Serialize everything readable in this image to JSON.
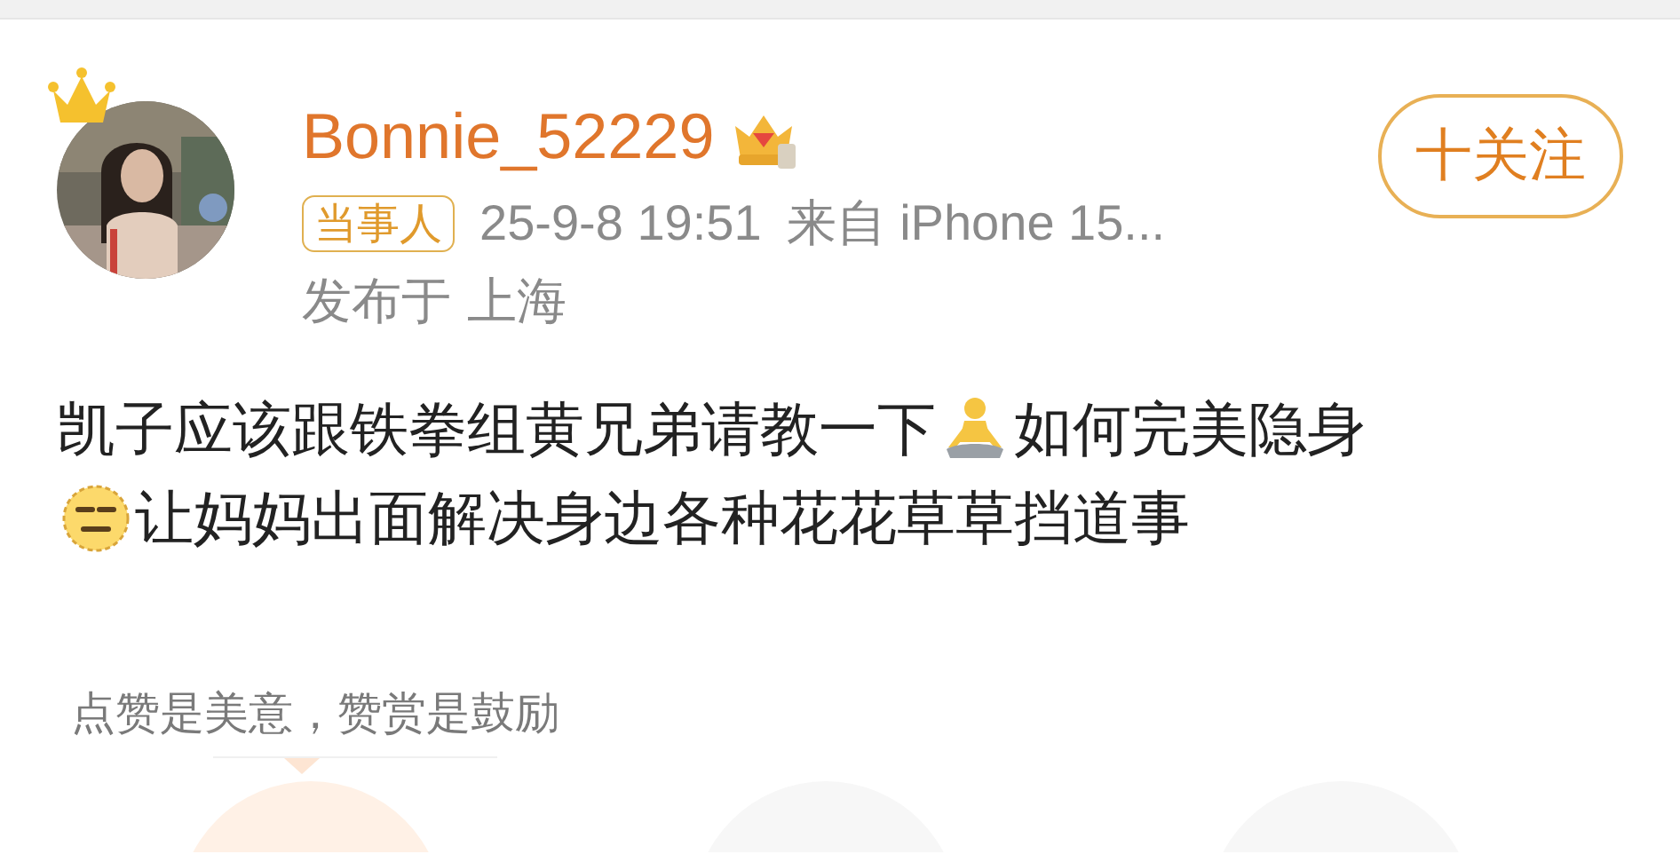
{
  "author": {
    "name": "Bonnie_52229",
    "badge": "当事人",
    "time": "25-9-8 19:51",
    "source": "来自 iPhone 15...",
    "location": "发布于 上海"
  },
  "follow_button": {
    "label": "十关注"
  },
  "post": {
    "lines": [
      {
        "segments": [
          {
            "kind": "text",
            "text": "凯子应该跟铁拳组黄兄弟请教一下"
          },
          {
            "kind": "meditation_emoji"
          },
          {
            "kind": "text",
            "text": "如何完美隐身"
          }
        ]
      },
      {
        "segments": [
          {
            "kind": "neutral_face_emoji"
          },
          {
            "kind": "text",
            "text": "让妈妈出面解决身边各种花花草草挡道事"
          }
        ]
      }
    ]
  },
  "reward": {
    "caption": "点赞是美意，赞赏是鼓励"
  }
}
